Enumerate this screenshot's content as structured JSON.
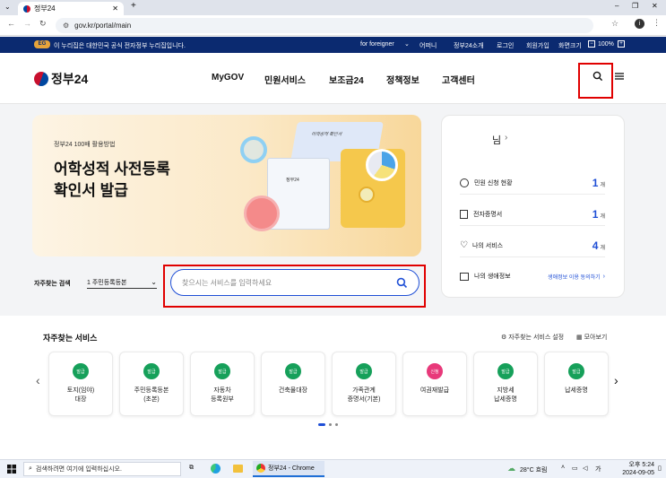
{
  "browser": {
    "tab_title": "정부24",
    "url": "gov.kr/portal/main",
    "new_tab": "+"
  },
  "topstrip": {
    "notice": "이 누리집은 대한민국 공식 전자정부 누리집입니다.",
    "links": [
      "for foreigner",
      "어떠니",
      "정부24소개",
      "로그인",
      "회원가입",
      "화면크기",
      "100%"
    ]
  },
  "header": {
    "logo_text": "정부24",
    "nav": [
      "MyGOV",
      "민원서비스",
      "보조금24",
      "정책정보",
      "고객센터"
    ]
  },
  "banner": {
    "kicker": "정부24 100배 활용방법",
    "title_line1": "어학성적 사전등록",
    "title_line2": "확인서 발급",
    "doc_label": "어학성적 확인서",
    "doc_brand": "정부24"
  },
  "search": {
    "label": "자주찾는 검색",
    "select_value": "1 주민등록등본",
    "placeholder": "찾으시는 서비스를 입력하세요"
  },
  "user_panel": {
    "greeting": "님",
    "rows": [
      {
        "label": "민원 신청 현황",
        "count": "1",
        "unit": "개"
      },
      {
        "label": "전자증명서",
        "count": "1",
        "unit": "개"
      },
      {
        "label": "나의 서비스",
        "count": "4",
        "unit": "개"
      }
    ],
    "last_label": "나의 생애정보",
    "last_link": "생애정보 이용 동의하기"
  },
  "services": {
    "title": "자주찾는 서비스",
    "settings": "자주찾는 서비스 설정",
    "view_all": "모아보기",
    "items": [
      {
        "label": "토지(임야)\n대장",
        "badge": "발급",
        "color": "#16a05a"
      },
      {
        "label": "주민등록등본\n(초본)",
        "badge": "발급",
        "color": "#16a05a"
      },
      {
        "label": "자동차\n등록원부",
        "badge": "발급",
        "color": "#16a05a"
      },
      {
        "label": "건축물대장",
        "badge": "발급",
        "color": "#16a05a"
      },
      {
        "label": "가족관계\n증명서(기본)",
        "badge": "발급",
        "color": "#16a05a"
      },
      {
        "label": "여권재발급",
        "badge": "신청",
        "color": "#e8397a"
      },
      {
        "label": "지방세\n납세증명",
        "badge": "발급",
        "color": "#16a05a"
      },
      {
        "label": "납세증명",
        "badge": "발급",
        "color": "#16a05a"
      }
    ]
  },
  "taskbar": {
    "search_placeholder": "검색하려면 여기에 입력하십시오.",
    "active_window": "정부24 - Chrome",
    "weather": "28°C 흐림",
    "time": "오후 5:24",
    "date": "2024-09-05"
  }
}
